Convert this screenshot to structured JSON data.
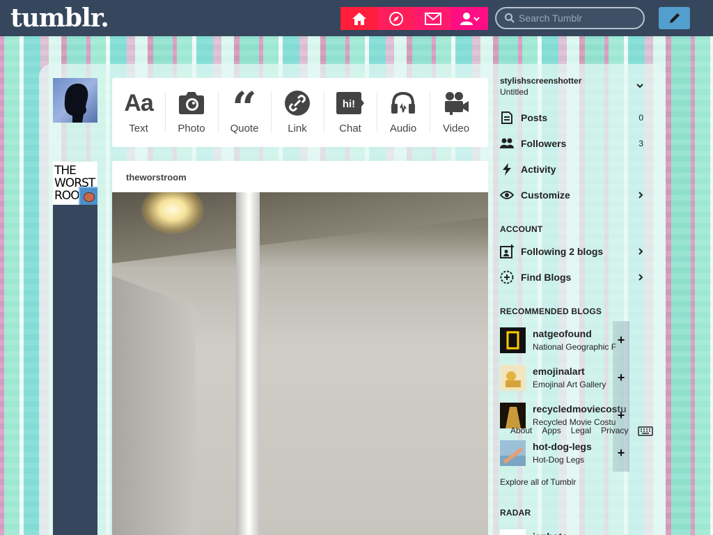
{
  "header": {
    "logo": "tumblr.",
    "nav": [
      {
        "name": "home",
        "color": "#ff1e3c"
      },
      {
        "name": "explore",
        "color": "#ff1e5a"
      },
      {
        "name": "inbox",
        "color": "#ff1a6e"
      },
      {
        "name": "account",
        "color": "#ff0d82"
      }
    ],
    "search": {
      "placeholder": "Search Tumblr",
      "value": ""
    },
    "compose_color": "#529ecc"
  },
  "post_types": [
    {
      "label": "Text",
      "icon": "text-icon"
    },
    {
      "label": "Photo",
      "icon": "camera-icon"
    },
    {
      "label": "Quote",
      "icon": "quote-icon"
    },
    {
      "label": "Link",
      "icon": "link-icon"
    },
    {
      "label": "Chat",
      "icon": "chat-icon",
      "glyph": "hi!"
    },
    {
      "label": "Audio",
      "icon": "headphones-icon"
    },
    {
      "label": "Video",
      "icon": "video-camera-icon"
    }
  ],
  "post_type_glyphs": {
    "text": "Aa"
  },
  "blog_avatar": {
    "text": "THE WORST ROO"
  },
  "post": {
    "blog_name": "theworstroom"
  },
  "sidebar": {
    "account_name": "stylishscreenshotter",
    "account_subtitle": "Untitled",
    "menu": [
      {
        "label": "Posts",
        "count": "0",
        "icon": "posts-icon"
      },
      {
        "label": "Followers",
        "count": "3",
        "icon": "followers-icon"
      },
      {
        "label": "Activity",
        "count": "",
        "icon": "activity-icon"
      },
      {
        "label": "Customize",
        "count": "",
        "icon": "eye-icon"
      }
    ],
    "account_section": {
      "title": "ACCOUNT",
      "items": [
        {
          "label": "Following 2 blogs",
          "icon": "following-icon"
        },
        {
          "label": "Find Blogs",
          "icon": "find-blogs-icon"
        }
      ]
    },
    "recommended": {
      "title": "RECOMMENDED BLOGS",
      "items": [
        {
          "name": "natgeofound",
          "title": "National Geographic F",
          "avatar_color": "#111111"
        },
        {
          "name": "emojinalart",
          "title": "Emojinal Art Gallery",
          "avatar_color": "#f2e6c0"
        },
        {
          "name": "recycledmoviecostu",
          "title": "Recycled Movie Costu",
          "avatar_color": "#8a6a2a"
        },
        {
          "name": "hot-dog-legs",
          "title": "Hot-Dog Legs",
          "avatar_color": "#9cc0d8"
        }
      ],
      "explore_label": "Explore all of Tumblr"
    },
    "footer_links": [
      "About",
      "Apps",
      "Legal",
      "Privacy"
    ],
    "radar": {
      "title": "RADAR",
      "item_name": "isphoto"
    }
  }
}
